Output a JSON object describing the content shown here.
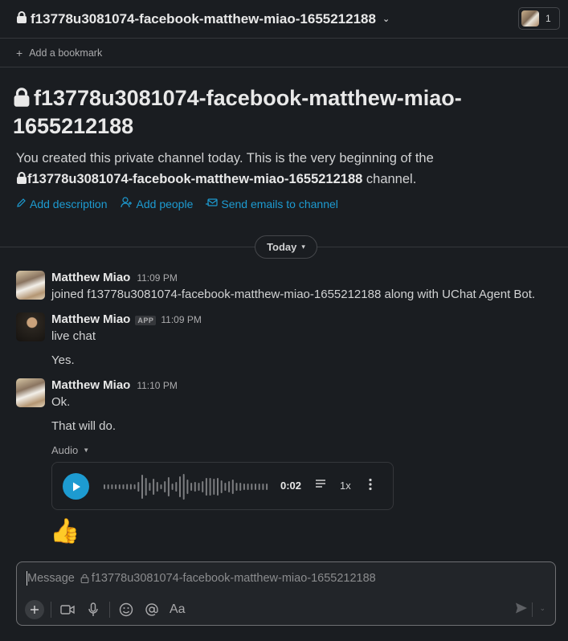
{
  "header": {
    "channel_name": "f13778u3081074-facebook-matthew-miao-1655212188",
    "member_count": "1"
  },
  "bookmarks": {
    "add_label": "Add a bookmark"
  },
  "intro": {
    "title": "f13778u3081074-facebook-matthew-miao-1655212188",
    "desc_prefix": "You created this private channel today. This is the very beginning of the",
    "desc_channel": "f13778u3081074-facebook-matthew-miao-1655212188",
    "desc_suffix": "channel.",
    "actions": [
      "Add description",
      "Add people",
      "Send emails to channel"
    ]
  },
  "day_divider": {
    "label": "Today"
  },
  "messages": [
    {
      "author": "Matthew Miao",
      "time": "11:09 PM",
      "lines": [
        "joined f13778u3081074-facebook-matthew-miao-1655212188 along with UChat Agent Bot."
      ]
    },
    {
      "author": "Matthew Miao",
      "badge": "APP",
      "time": "11:09 PM",
      "lines": [
        "live chat",
        "Yes."
      ]
    },
    {
      "author": "Matthew Miao",
      "time": "11:10 PM",
      "lines": [
        "Ok.",
        "That will do."
      ]
    }
  ],
  "audio": {
    "label": "Audio",
    "duration": "0:02",
    "speed": "1x"
  },
  "reaction_emoji": "👍",
  "composer": {
    "placeholder_prefix": "Message",
    "placeholder_channel": "f13778u3081074-facebook-matthew-miao-1655212188",
    "format_label": "Aa"
  },
  "colors": {
    "background": "#1a1d21",
    "accent_link": "#1d9bd1",
    "border": "#35373b"
  }
}
